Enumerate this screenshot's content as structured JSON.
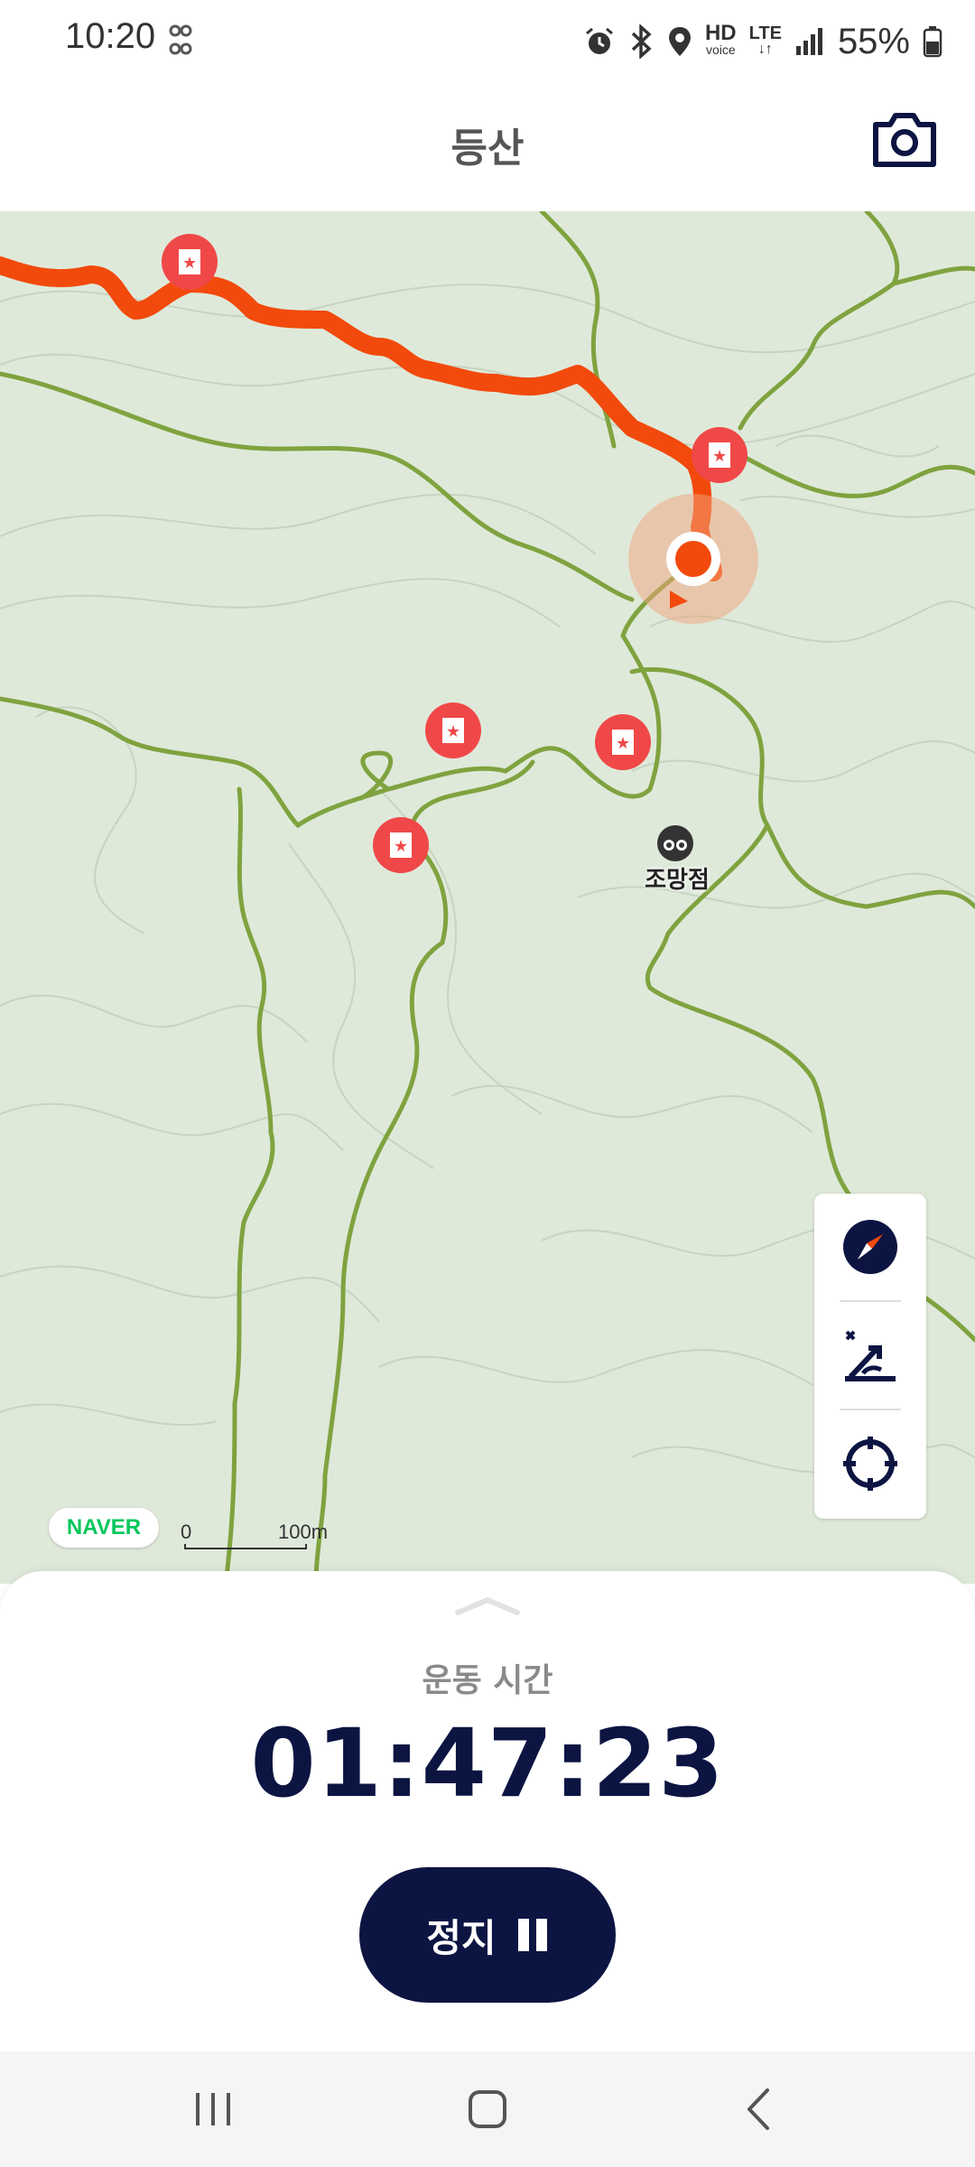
{
  "status_bar": {
    "time": "10:20",
    "network": "LTE",
    "hd_voice_top": "HD",
    "hd_voice_bottom": "voice",
    "battery": "55%"
  },
  "header": {
    "title": "등산",
    "camera_icon": "camera-icon"
  },
  "map": {
    "poi_label": "조망점",
    "attribution": "NAVER",
    "scale_start": "0",
    "scale_distance": "100m",
    "colors": {
      "terrain": "#dfe9da",
      "trail": "#7fa33f",
      "route": "#f24a0c",
      "marker": "#f04848"
    },
    "controls": [
      "compass-icon",
      "elevation-icon",
      "locate-icon"
    ]
  },
  "workout": {
    "label": "운동 시간",
    "elapsed": "01:47:23",
    "stop_label": "정지"
  },
  "nav_bar": {
    "items": [
      "recent-apps-icon",
      "home-icon",
      "back-icon"
    ]
  }
}
